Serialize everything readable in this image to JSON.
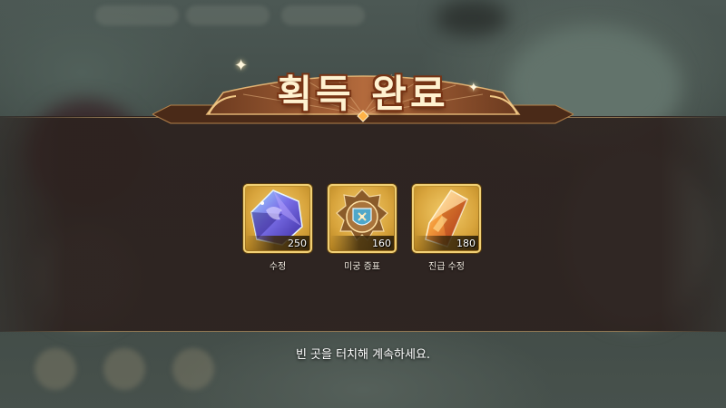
{
  "banner": {
    "title": "획득 완료"
  },
  "rewards": [
    {
      "name": "수정",
      "count": "250",
      "icon": "crystal-icon",
      "color": "#7a6fe8"
    },
    {
      "name": "미궁 증표",
      "count": "160",
      "icon": "labyrinth-emblem-icon",
      "color": "#4fa7c9"
    },
    {
      "name": "진급 수정",
      "count": "180",
      "icon": "promotion-crystal-icon",
      "color": "#e0662a"
    }
  ],
  "hint": "빈 곳을 터치해 계속하세요.",
  "colors": {
    "panel": "#2d221f",
    "title": "#fff2d0",
    "frame": "#c99b35",
    "banner": "#b5603a"
  }
}
